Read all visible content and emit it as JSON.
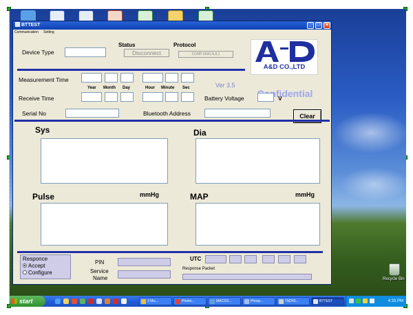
{
  "window": {
    "title": "BTTEST"
  },
  "menu": {
    "items": [
      "Communication",
      "Setting"
    ]
  },
  "device": {
    "type_label": "Device Type",
    "status_label": "Status",
    "status_value": "Disconnect",
    "protocol_label": "Protocol",
    "protocol_value": "COMP:0600,N,8,1"
  },
  "measurement": {
    "label": "Measurement Time",
    "date_labels": {
      "year": "Year",
      "month": "Month",
      "day": "Day"
    },
    "time_labels": {
      "hour": "Hour",
      "minute": "Minute",
      "sec": "Sec"
    }
  },
  "receive": {
    "label": "Receive Time"
  },
  "version": "Ver 3.5",
  "logo": {
    "company": "A&D CO.,LTD",
    "mark_text": "A&D"
  },
  "confidential": "Confidential",
  "battery": {
    "label": "Battery Voltage",
    "unit": "V"
  },
  "serial": {
    "label": "Serial No"
  },
  "bluetooth": {
    "label": "Bluetooth Address"
  },
  "clear_button": "Clear",
  "readings": {
    "sys": {
      "label": "Sys"
    },
    "dia": {
      "label": "Dia"
    },
    "pulse": {
      "label": "Pulse",
      "unit": "mmHg"
    },
    "map": {
      "label": "MAP",
      "unit": "mmHg"
    }
  },
  "response": {
    "group_label": "Responce",
    "options": [
      {
        "label": "Accept",
        "selected": true
      },
      {
        "label": "Configure",
        "selected": false
      }
    ],
    "pin_label": "PIN",
    "service_label": "Service",
    "name_label": "Name",
    "utc_label": "UTC",
    "packet_label": "Response Packet"
  },
  "taskbar": {
    "start_label": "start",
    "tasks": [
      "3 Mic...",
      "Photel...",
      "MACSO...",
      "Phosp...",
      "TM243...",
      "BTTEST"
    ],
    "active_task": "BTTEST",
    "clock": "4:33 PM"
  },
  "desktop": {
    "recycle_bin": "Recycle Bin"
  },
  "colors": {
    "title_bar": "#0b3fb0",
    "separator": "#1f2fa8",
    "confidential": "#9fa5f0",
    "logo_brand": "#1f2f9f",
    "window_bg": "#ece9d8"
  }
}
